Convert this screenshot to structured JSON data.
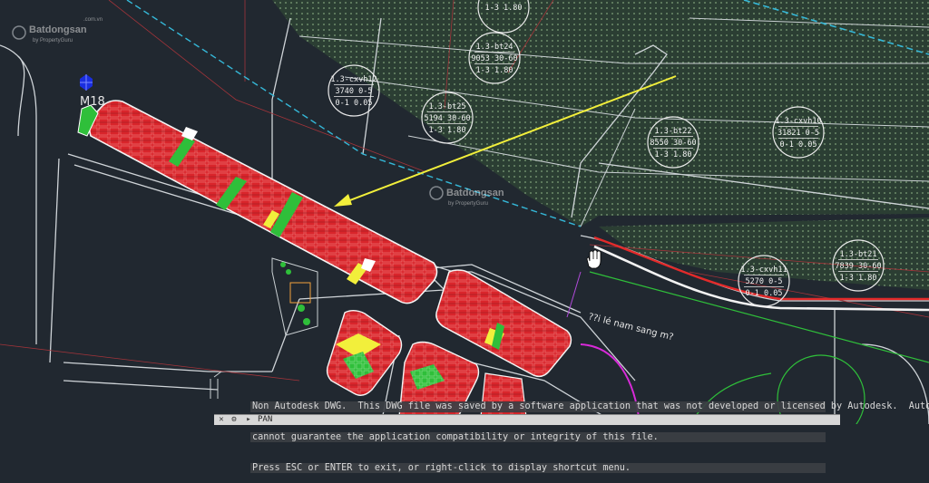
{
  "watermark": {
    "brand": "Batdongsan",
    "sub": "by PropertyGuru",
    "com": ".com.vn"
  },
  "map_labels": {
    "block_code": "M18",
    "road_note": "??i lé nam sang m?",
    "small_label": "...?"
  },
  "plot_tags": [
    {
      "lines": [
        "1.3-bt24",
        "9053 30-60",
        "1-3 1.80"
      ]
    },
    {
      "lines": [
        "1.3-cxvh12",
        "3740  0-5",
        "0-1 0.05"
      ]
    },
    {
      "lines": [
        "1.3-bt25",
        "5194 30-60",
        "1-3 1.80"
      ]
    },
    {
      "lines": [
        "1.3-bt22",
        "8550 30-60",
        "1-3 1.80"
      ]
    },
    {
      "lines": [
        "1.3-cxvh10",
        "31821  0-5",
        "0-1 0.05"
      ]
    },
    {
      "lines": [
        "1.3-bt21",
        "7839 30-60",
        "1-3 1.80"
      ]
    },
    {
      "lines": [
        "1.3-cxvh11",
        "5270  0-5",
        "0-1 0.05"
      ]
    },
    {
      "lines": [
        "1-3 1.80"
      ]
    }
  ],
  "command_line": {
    "messages": [
      "Non Autodesk DWG.  This DWG file was saved by a software application that was not developed or licensed by Autodesk.  Autodesk",
      "cannot guarantee the application compatibility or integrity of this file.",
      "Press ESC or ENTER to exit, or right-click to display shortcut menu."
    ],
    "current_command": "PAN",
    "close_icon": "close-icon",
    "settings_icon": "wrench-icon",
    "prompt_icon": "command-prompt-icon",
    "pan_cursor_icon": "hand-pan-icon"
  },
  "colors": {
    "background": "#212830",
    "lots_red": "#e0262b",
    "green_space": "#2e4a32",
    "arrow_yellow": "#f2ef3b",
    "road_white": "#e8e8e8",
    "cyan_boundary": "#35b8d8"
  }
}
